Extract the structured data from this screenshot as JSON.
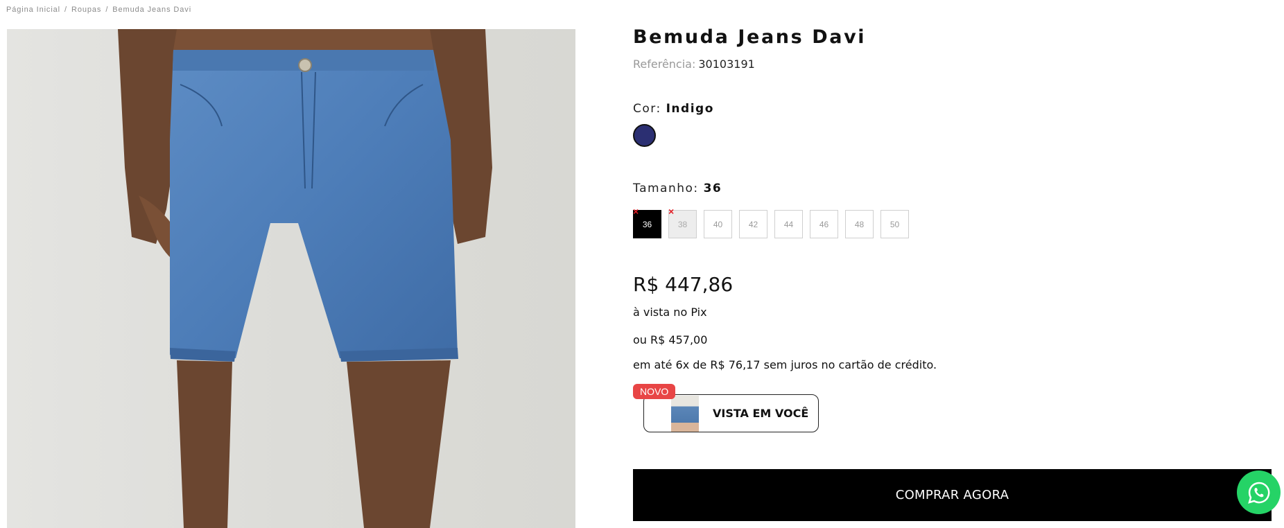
{
  "breadcrumb": {
    "items": [
      "Página Inicial",
      "Roupas",
      "Bemuda Jeans Davi"
    ],
    "separator": "/"
  },
  "product": {
    "title": "Bemuda Jeans Davi",
    "reference_label": "Referência:",
    "reference_value": "30103191",
    "image_alt": "bermuda-jeans-photo"
  },
  "color": {
    "label": "Cor:",
    "selected": "Indigo",
    "swatch_hex": "#2b2f72"
  },
  "size": {
    "label": "Tamanho:",
    "selected": "36",
    "options": [
      "36",
      "38",
      "40",
      "42",
      "44",
      "46",
      "48",
      "50"
    ],
    "unavailable": [
      "36",
      "38"
    ]
  },
  "pricing": {
    "pix_price": "R$ 447,86",
    "pix_note": "à vista no Pix",
    "card_price": "ou R$ 457,00",
    "installments": "em até 6x de R$ 76,17 sem juros no cartão de crédito."
  },
  "try_on": {
    "badge": "NOVO",
    "label": "VISTA EM VOCÊ"
  },
  "cta": {
    "buy_label": "COMPRAR AGORA"
  },
  "icons": {
    "whatsapp": "whatsapp-icon"
  },
  "colors": {
    "accent": "#000000",
    "badge": "#e84545",
    "whatsapp": "#25d366",
    "unavailable_x": "#e31b23"
  }
}
